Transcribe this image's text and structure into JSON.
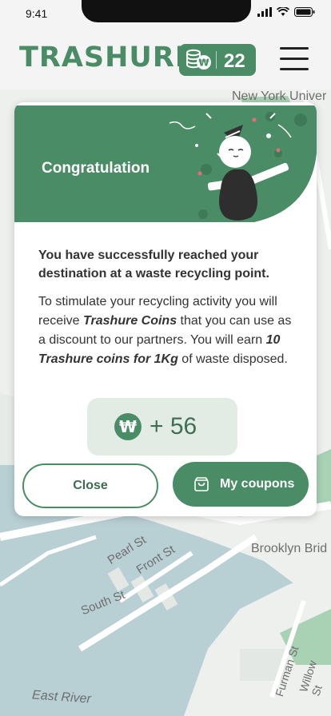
{
  "status_bar": {
    "time": "9:41"
  },
  "header": {
    "logo": "TRASHURE",
    "coin_count": "22"
  },
  "map": {
    "labels": {
      "new_york_univ": "New York Univer",
      "pearl_st": "Pearl St",
      "front_st": "Front St",
      "south_st": "South St",
      "brooklyn_bridge": "Brooklyn Brid",
      "east_river": "East River",
      "furman_st": "Furman St",
      "willow_st": "Willow St"
    }
  },
  "modal": {
    "title": "Congratulation",
    "lead": "You have successfully reached your destination at a waste recycling point.",
    "desc_1": "To stimulate your recycling activity you will receive ",
    "desc_brand": "Trashure Coins",
    "desc_2": " that you can use as a discount to our partners. You will earn ",
    "desc_bold": "10 Trashure coins for  1Kg",
    "desc_3": " of waste disposed.",
    "reward": "+ 56",
    "close_label": "Close",
    "coupons_label": "My coupons"
  },
  "colors": {
    "brand": "#4a8c66",
    "brand_light": "#e2ece5",
    "map_water": "#b8cfd4",
    "map_land": "#eef0ee"
  }
}
